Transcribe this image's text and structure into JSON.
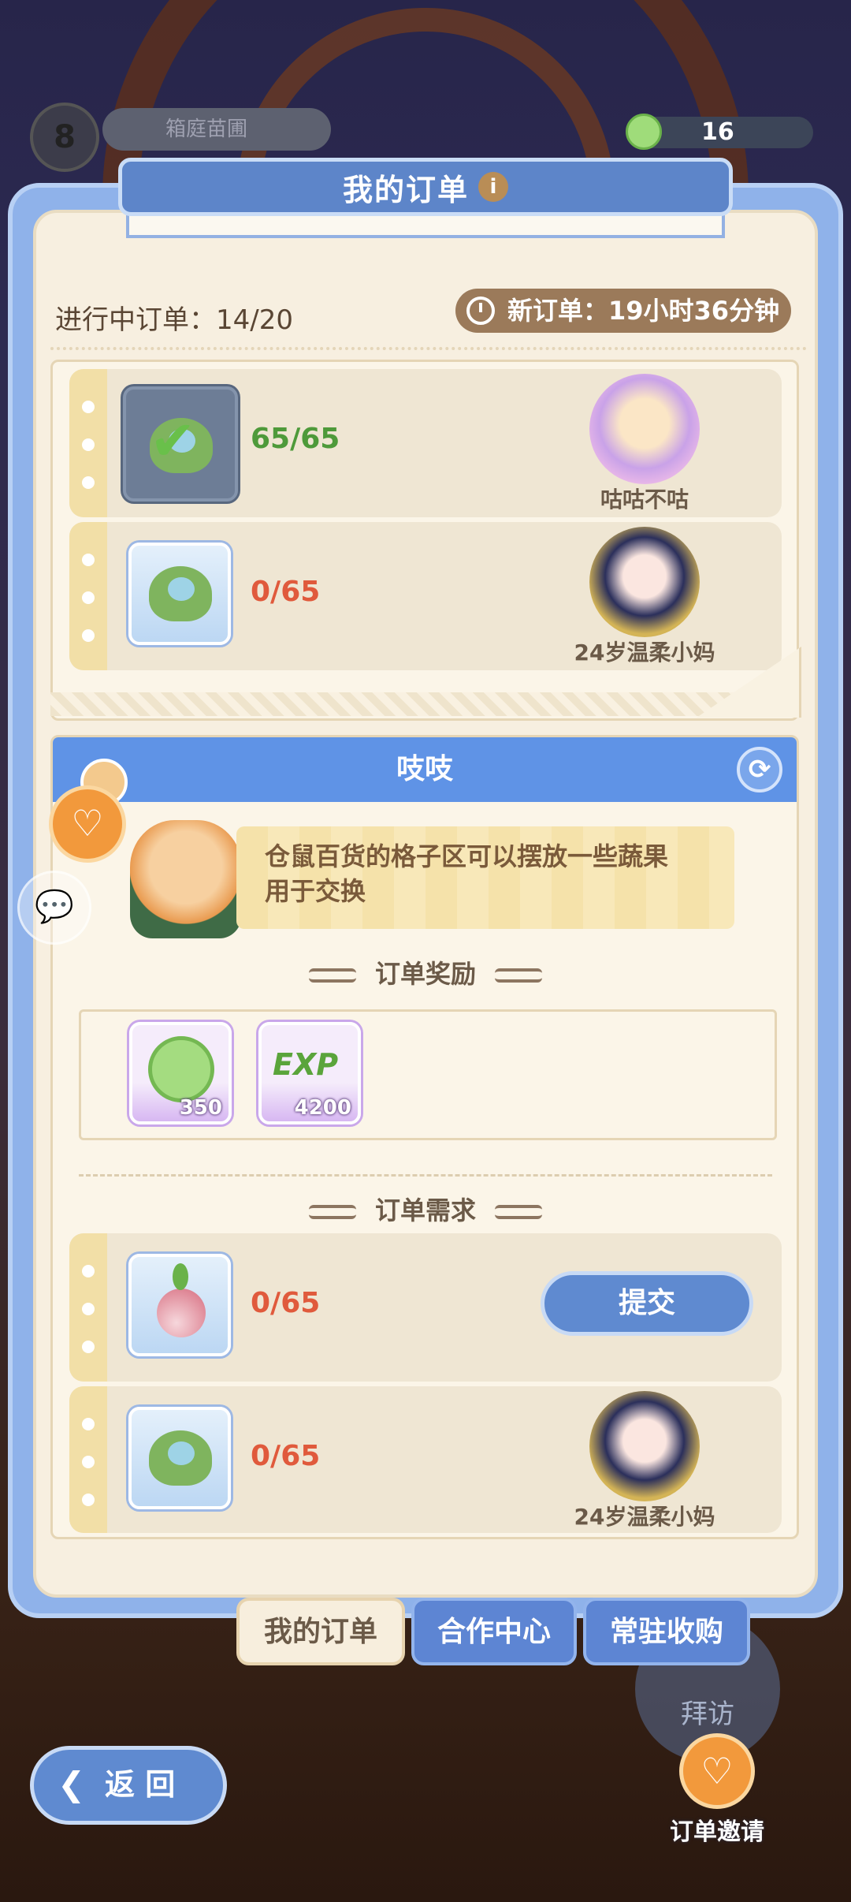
{
  "hud": {
    "level": "8",
    "farm_name": "箱庭苗圃",
    "coins": "16"
  },
  "panel": {
    "title": "我的订单",
    "progress_label": "进行中订单：14/20",
    "new_order_label": "新订单：19小时36分钟"
  },
  "order_a": {
    "rows": [
      {
        "count": "65/65",
        "requester": "咕咕不咕"
      },
      {
        "count": "0/65",
        "requester": "24岁温柔小妈"
      }
    ]
  },
  "order_b": {
    "name": "吱吱",
    "dialog": "仓鼠百货的格子区可以摆放一些蔬果\n用于交换",
    "reward_title": "订单奖励",
    "rewards": [
      {
        "icon": "clover-coin-icon",
        "amount": "350"
      },
      {
        "icon": "exp-clover-icon",
        "amount": "4200"
      }
    ],
    "demand_title": "订单需求",
    "demands": [
      {
        "icon": "radish-icon",
        "count": "0/65",
        "action": "提交"
      },
      {
        "icon": "cabbage-icon",
        "count": "0/65",
        "requester": "24岁温柔小妈"
      }
    ]
  },
  "tabs": [
    "我的订单",
    "合作中心",
    "常驻收购"
  ],
  "visit_label": "拜访",
  "back_label": "返 回",
  "invite_label": "订单邀请",
  "colors": {
    "accent": "#5f93e6",
    "ok": "#4e9a3a",
    "bad": "#e05a3c",
    "panel": "#f7efe0"
  }
}
